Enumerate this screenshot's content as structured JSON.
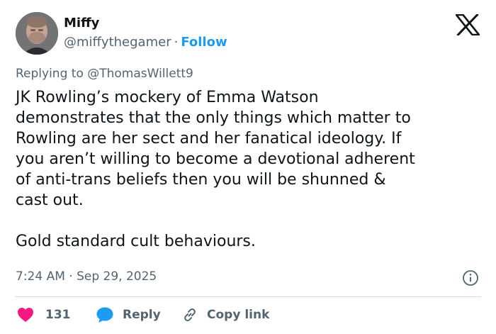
{
  "author": {
    "display_name": "Miffy",
    "handle": "@miffythegamer",
    "separator": "·",
    "follow_label": "Follow",
    "avatar_icon": "profile-photo"
  },
  "platform": {
    "logo_icon": "x-logo"
  },
  "reply_context": {
    "prefix": "Replying to",
    "to_handle": "@ThomasWillett9"
  },
  "tweet": {
    "lines": [
      "JK Rowling’s mockery of Emma Watson",
      "demonstrates that the only things which matter to",
      "Rowling are her sect and her fanatical ideology. If",
      "you aren’t willing to become a devotional adherent",
      "of anti-trans beliefs then you will be shunned &",
      "cast out.",
      "Gold standard cult behaviours."
    ],
    "timestamp": "7:24 AM · Sep 29, 2025"
  },
  "actions": {
    "like_count": "131",
    "reply_label": "Reply",
    "copy_link_label": "Copy link"
  },
  "colors": {
    "text": "#0f1419",
    "secondary": "#536471",
    "link": "#1d9bf0",
    "like": "#f91880",
    "reply_bubble": "#1d9bf0",
    "divider": "#cfd9de"
  }
}
